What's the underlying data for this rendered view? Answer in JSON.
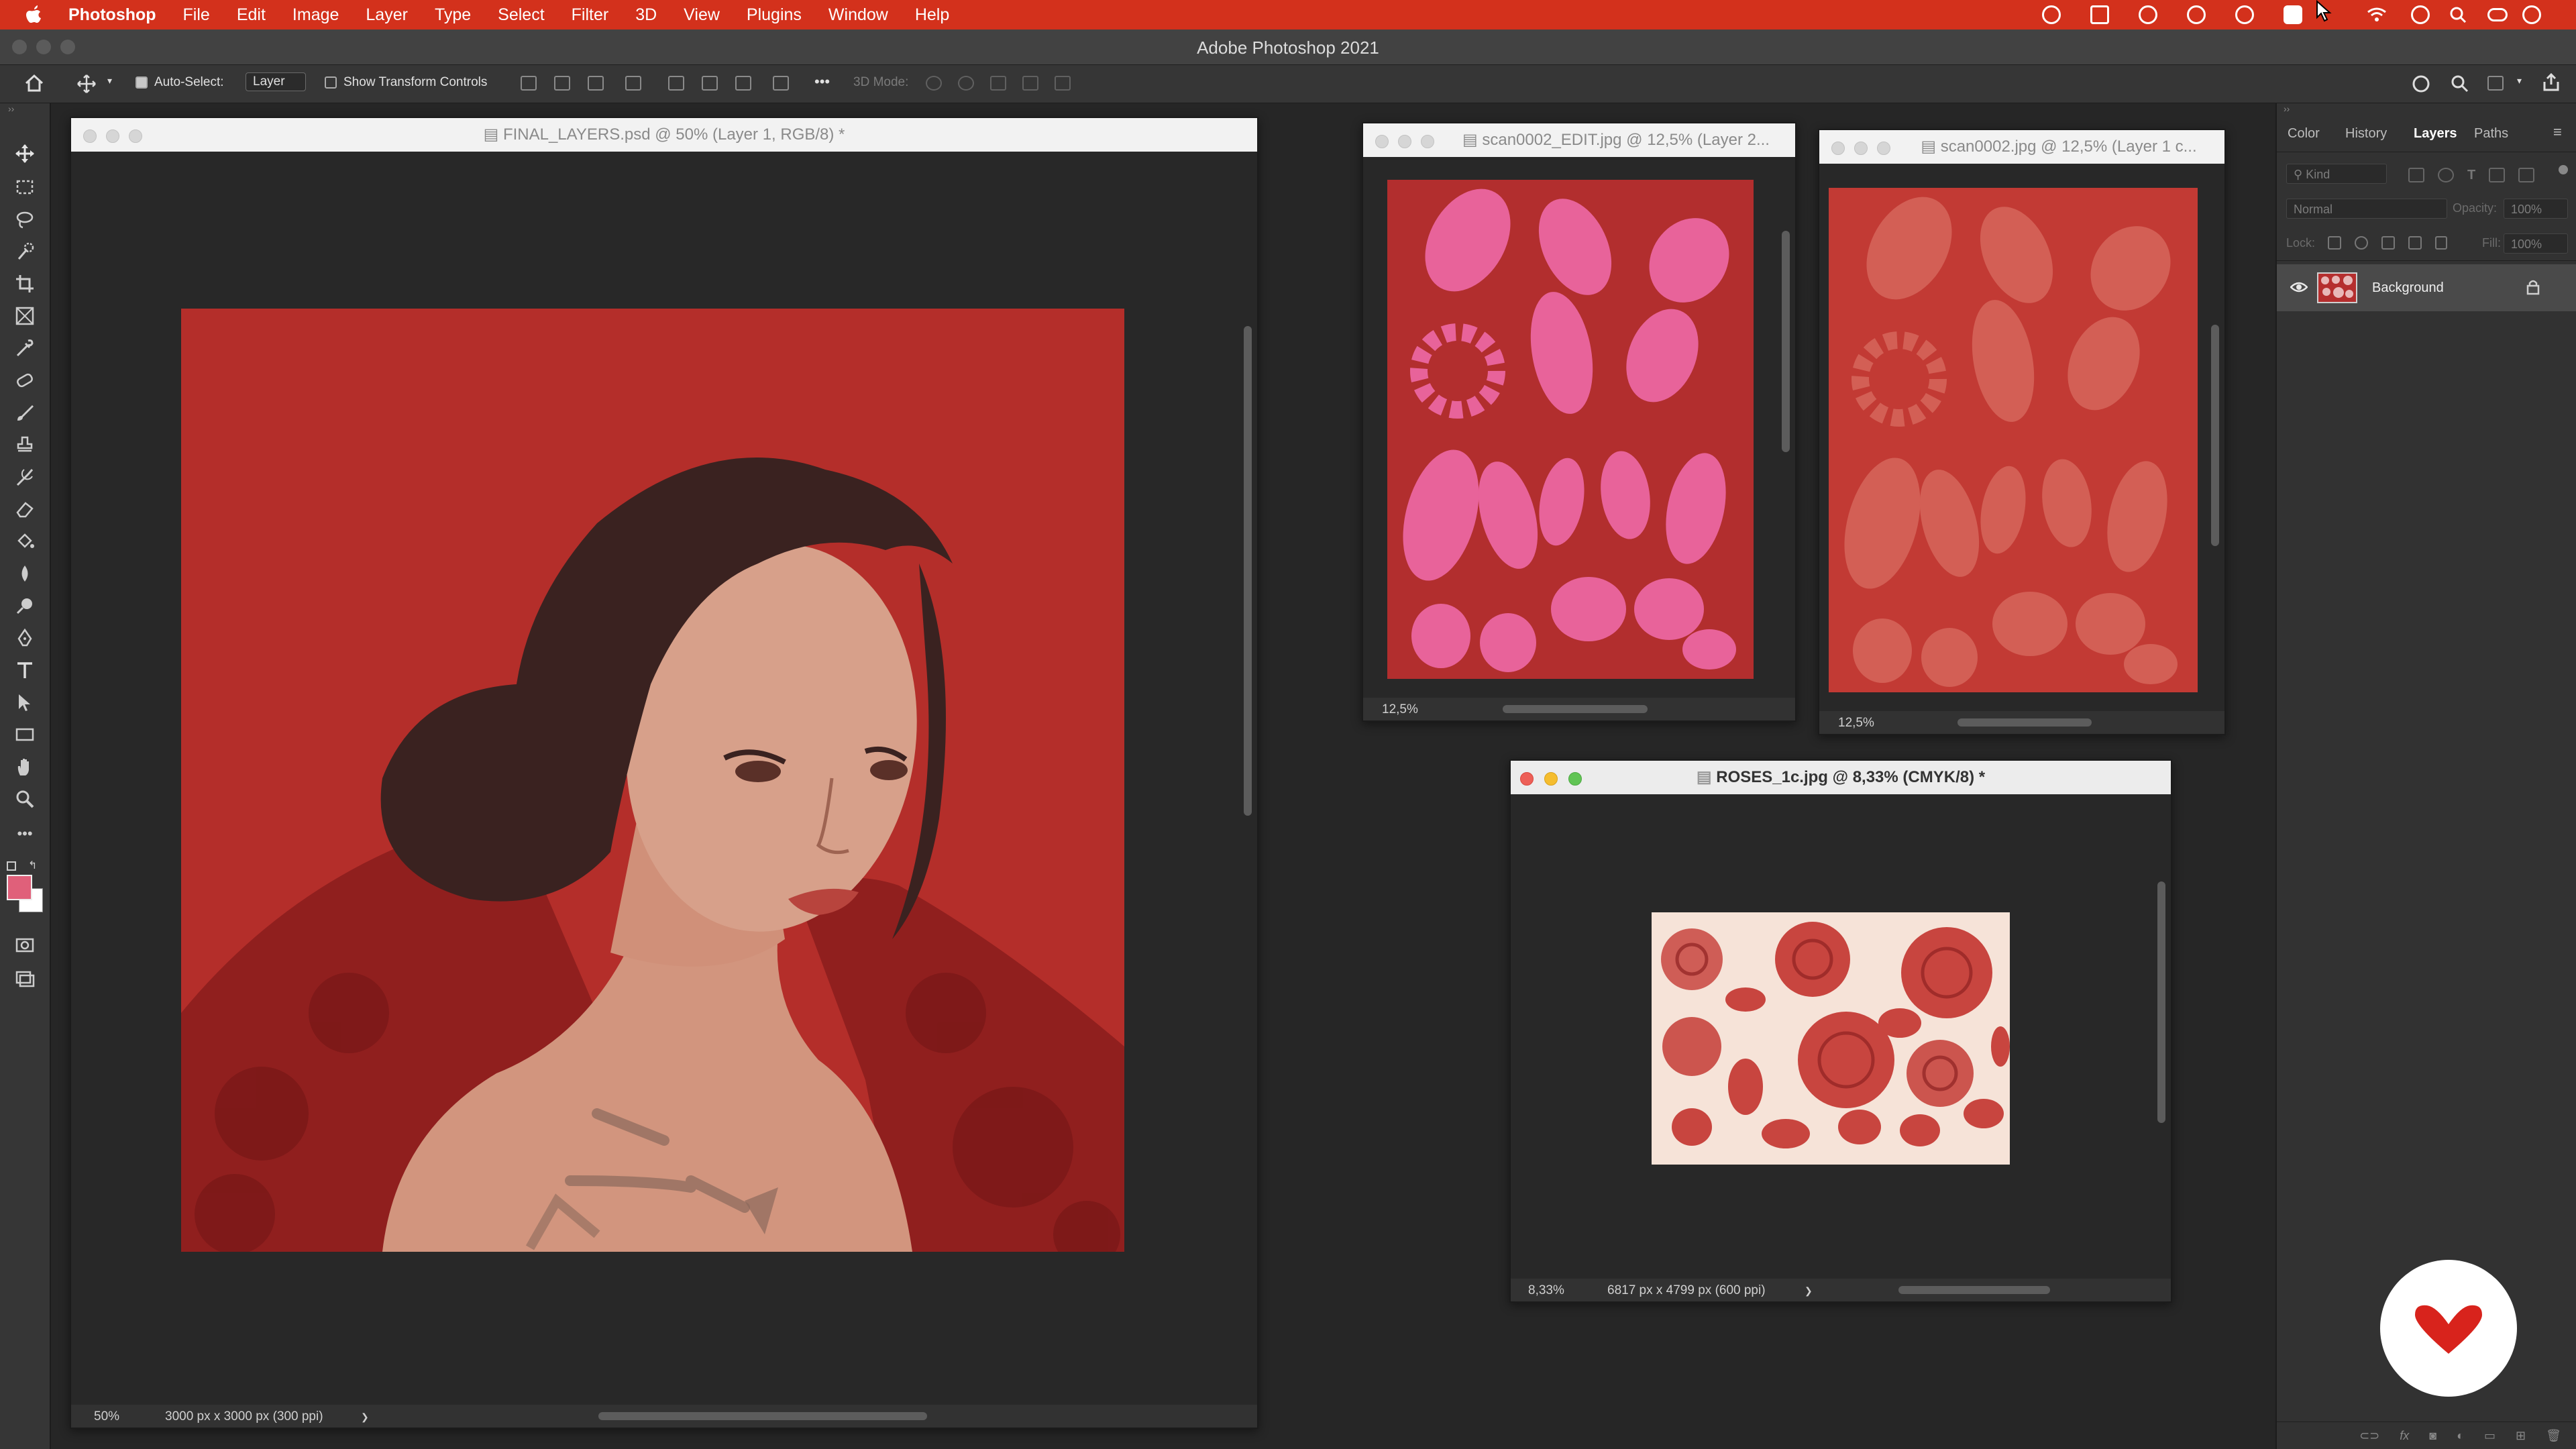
{
  "menubar": {
    "app": "Photoshop",
    "items": [
      "File",
      "Edit",
      "Image",
      "Layer",
      "Type",
      "Select",
      "Filter",
      "3D",
      "View",
      "Plugins",
      "Window",
      "Help"
    ],
    "status_icons": [
      "sync-icon",
      "screen-icon",
      "cc-icon",
      "cloud-icon",
      "star-icon",
      "s-icon",
      "cursor-icon",
      "wifi-icon",
      "user-icon",
      "search-icon",
      "control-center-icon",
      "clock-icon"
    ]
  },
  "app_title": "Adobe Photoshop 2021",
  "options": {
    "auto_select_label": "Auto-Select:",
    "auto_select_value": "Layer",
    "show_transform_label": "Show Transform Controls",
    "mode_3d_label": "3D Mode:",
    "more": "•••"
  },
  "docs": {
    "final": {
      "title": "FINAL_LAYERS.psd @ 50% (Layer 1, RGB/8) *",
      "zoom": "50%",
      "size": "3000 px x 3000 px (300 ppi)",
      "arrow": "❯"
    },
    "scan_edit": {
      "title": "scan0002_EDIT.jpg @ 12,5% (Layer 2...",
      "zoom": "12,5%"
    },
    "scan": {
      "title": "scan0002.jpg @ 12,5% (Layer 1 c...",
      "zoom": "12,5%"
    },
    "roses": {
      "title": "ROSES_1c.jpg @ 8,33% (CMYK/8) *",
      "zoom": "8,33%",
      "size": "6817 px x 4799 px (600 ppi)",
      "arrow": "❯"
    }
  },
  "panel": {
    "tabs": [
      "Color",
      "History",
      "Layers",
      "Paths"
    ],
    "active_tab": "Layers",
    "filter_placeholder": "Kind",
    "blend_mode": "Normal",
    "opacity_label": "Opacity:",
    "opacity_value": "100%",
    "lock_label": "Lock:",
    "fill_label": "Fill:",
    "fill_value": "100%",
    "layers": [
      {
        "name": "Background",
        "visible": true,
        "locked": true
      }
    ]
  },
  "colors": {
    "menubar": "#d3311c",
    "canvas_red": "#b42e2a",
    "foreground": "#e0607a"
  }
}
